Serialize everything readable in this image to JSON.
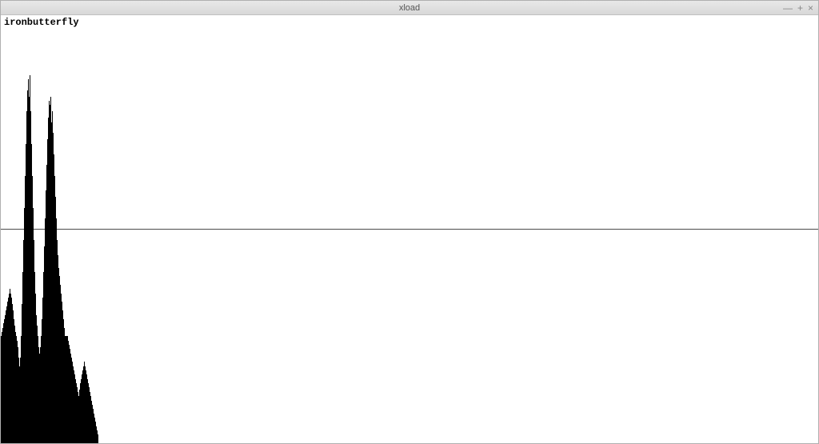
{
  "window": {
    "title": "xload",
    "controls": {
      "minimize": "—",
      "maximize": "+",
      "close": "×"
    }
  },
  "hostname": "ironbutterfly",
  "chart_data": {
    "type": "bar",
    "title": "",
    "xlabel": "",
    "ylabel": "",
    "ylim": [
      0,
      2
    ],
    "scale_lines": [
      1
    ],
    "values": [
      0.5,
      0.52,
      0.54,
      0.56,
      0.58,
      0.6,
      0.62,
      0.64,
      0.66,
      0.68,
      0.7,
      0.72,
      0.7,
      0.68,
      0.65,
      0.62,
      0.58,
      0.55,
      0.52,
      0.5,
      0.48,
      0.45,
      0.4,
      0.36,
      0.4,
      0.5,
      0.65,
      0.8,
      0.95,
      1.1,
      1.25,
      1.4,
      1.55,
      1.65,
      1.7,
      1.62,
      1.72,
      1.55,
      1.4,
      1.25,
      1.1,
      0.95,
      0.8,
      0.7,
      0.6,
      0.55,
      0.5,
      0.45,
      0.42,
      0.45,
      0.5,
      0.58,
      0.68,
      0.8,
      0.92,
      1.05,
      1.18,
      1.3,
      1.42,
      1.52,
      1.6,
      1.58,
      1.62,
      1.5,
      1.55,
      1.45,
      1.35,
      1.25,
      1.15,
      1.05,
      0.95,
      0.88,
      0.82,
      0.78,
      0.74,
      0.7,
      0.66,
      0.62,
      0.58,
      0.54,
      0.5,
      0.5,
      0.5,
      0.5,
      0.48,
      0.46,
      0.44,
      0.42,
      0.4,
      0.38,
      0.36,
      0.34,
      0.32,
      0.3,
      0.28,
      0.26,
      0.24,
      0.22,
      0.25,
      0.28,
      0.3,
      0.32,
      0.34,
      0.36,
      0.38,
      0.36,
      0.34,
      0.32,
      0.3,
      0.28,
      0.26,
      0.24,
      0.22,
      0.2,
      0.18,
      0.16,
      0.14,
      0.12,
      0.1,
      0.08,
      0.06,
      0.04
    ]
  }
}
